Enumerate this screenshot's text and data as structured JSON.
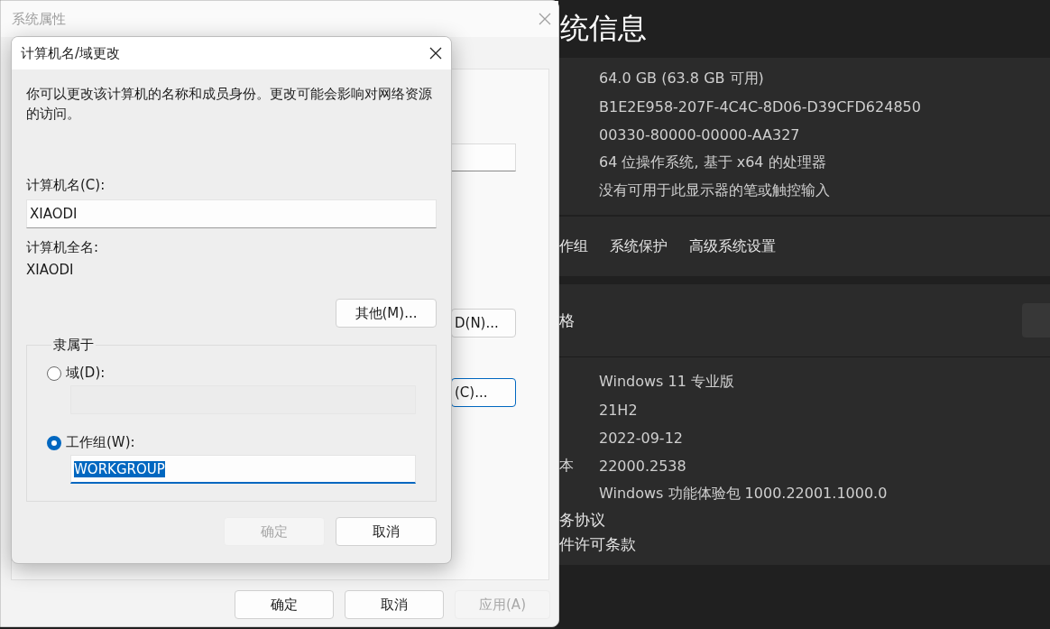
{
  "settings": {
    "title": "统信息",
    "specs": [
      "64.0 GB (63.8 GB 可用)",
      "B1E2E958-207F-4C4C-8D06-D39CFD624850",
      "00330-80000-00000-AA327",
      "64 位操作系统, 基于 x64 的处理器",
      "没有可用于此显示器的笔或触控输入"
    ],
    "links": [
      "作组",
      "系统保护",
      "高级系统设置"
    ],
    "section": {
      "title": "格",
      "rows": [
        {
          "value": "Windows 11 专业版"
        },
        {
          "value": "21H2"
        },
        {
          "value": "2022-09-12"
        },
        {
          "label": "本",
          "value": "22000.2538"
        },
        {
          "value": "Windows 功能体验包 1000.22001.1000.0"
        }
      ],
      "agreements": [
        "务协议",
        "件许可条款"
      ]
    }
  },
  "system_properties": {
    "title": "系统属性",
    "buttons": [
      {
        "label": "D(N)...",
        "focused": false
      },
      {
        "label": "(C)...",
        "focused": true
      }
    ],
    "footer_buttons": [
      {
        "label": "确定",
        "disabled": false
      },
      {
        "label": "取消",
        "disabled": false
      },
      {
        "label": "应用(A)",
        "disabled": true
      }
    ]
  },
  "dialog": {
    "title": "计算机名/域更改",
    "description": "你可以更改该计算机的名称和成员身份。更改可能会影响对网络资源的访问。",
    "computer_name_label": "计算机名(C):",
    "computer_name": "XIAODI",
    "full_name_label": "计算机全名:",
    "full_name": "XIAODI",
    "more_button": "其他(M)...",
    "member_of": {
      "legend": "隶属于",
      "options": [
        {
          "label": "域(D):",
          "selected": false
        },
        {
          "label": "工作组(W):",
          "selected": true,
          "value": "WORKGROUP",
          "text_selected": true
        }
      ]
    },
    "buttons": [
      {
        "label": "确定",
        "disabled": true
      },
      {
        "label": "取消",
        "disabled": false
      }
    ]
  }
}
